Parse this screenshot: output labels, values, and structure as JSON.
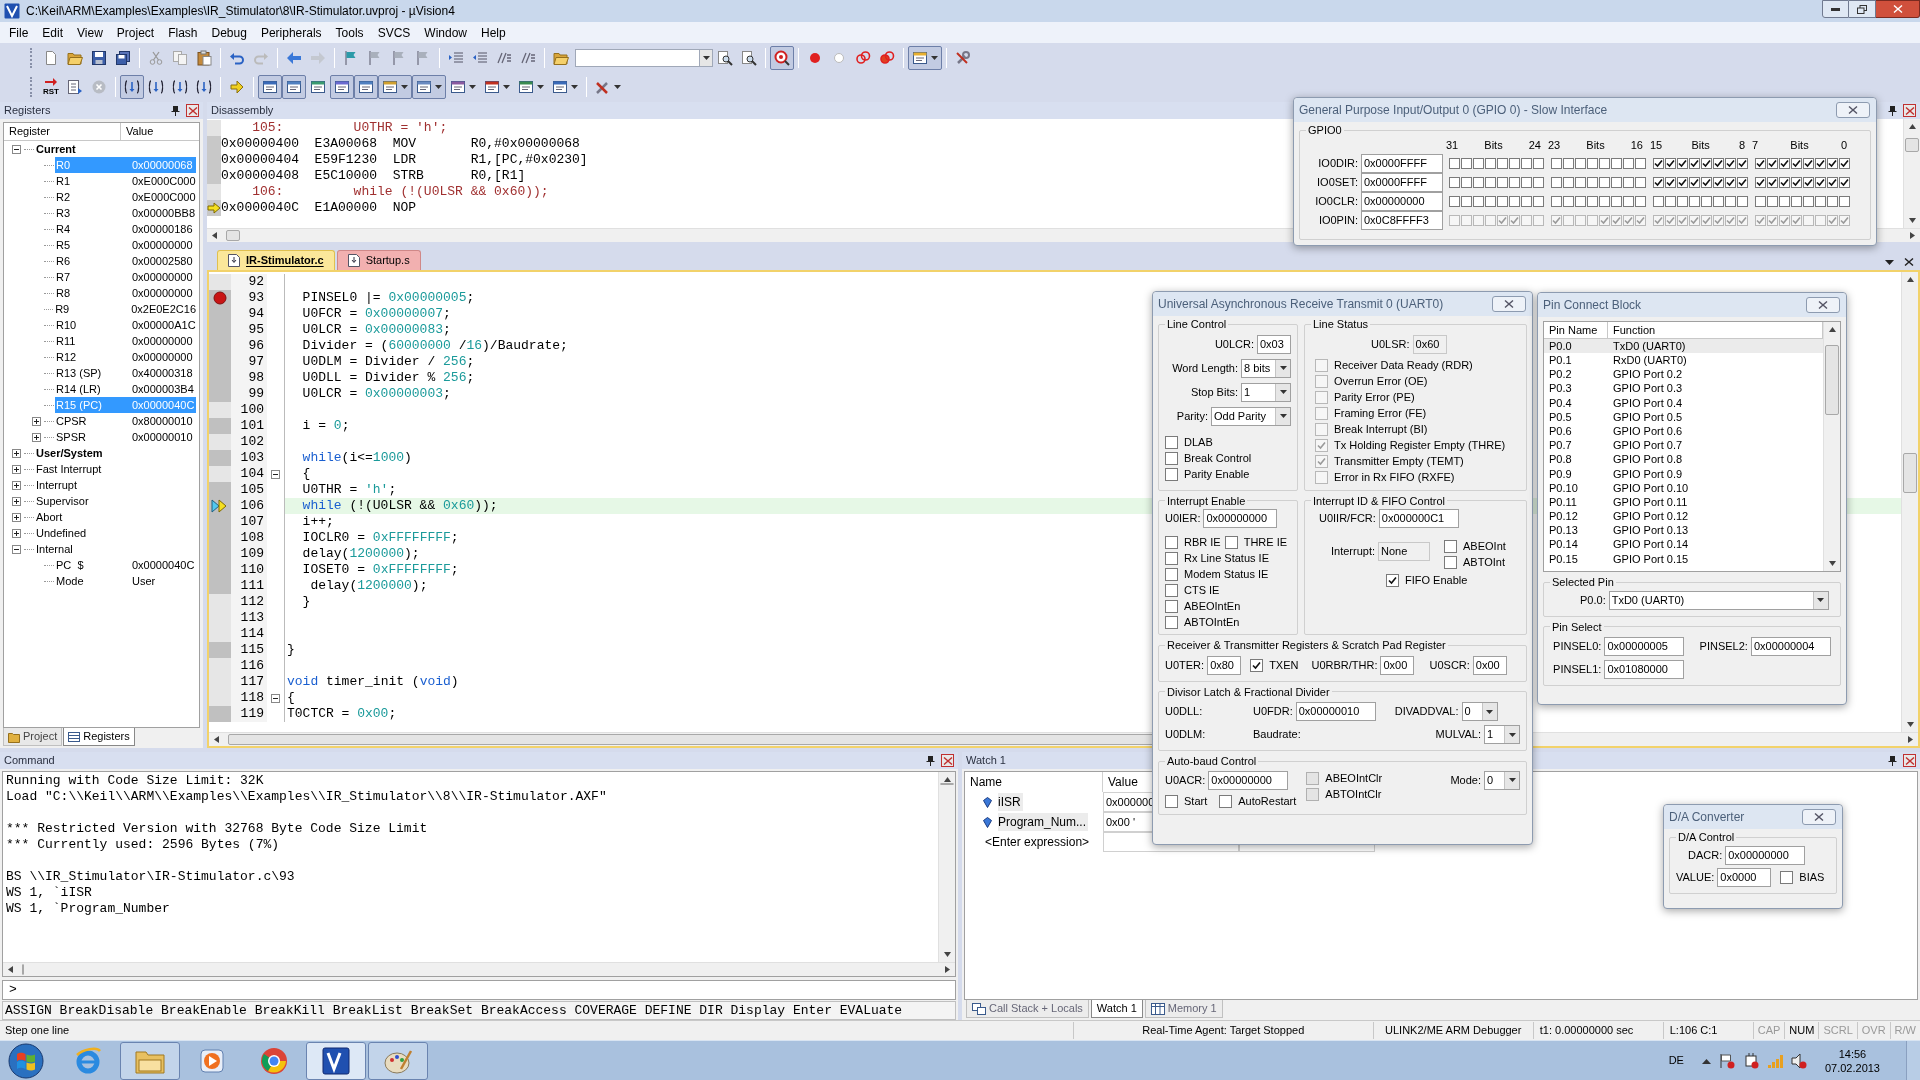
{
  "window": {
    "title": "C:\\Keil\\ARM\\Examples\\Examples\\IR_Stimulator\\8\\IR-Stimulator.uvproj - µVision4"
  },
  "menu": [
    "File",
    "Edit",
    "View",
    "Project",
    "Flash",
    "Debug",
    "Peripherals",
    "Tools",
    "SVCS",
    "Window",
    "Help"
  ],
  "toolbars": [
    {
      "buttons": [
        {
          "pressed": false
        },
        {
          "pressed": false
        },
        {
          "pressed": false
        },
        {
          "pressed": false
        },
        {
          "pressed": false
        },
        {
          "pressed": false
        },
        {
          "pressed": false
        },
        {
          "pressed": false
        },
        {
          "pressed": false
        },
        {
          "pressed": false
        },
        {
          "pressed": false
        },
        {
          "pressed": false
        },
        {
          "pressed": false
        },
        {
          "pressed": false
        },
        {
          "pressed": false
        },
        {
          "pressed": false
        },
        {
          "pressed": false
        },
        {
          "pressed": false
        },
        {
          "pressed": false
        },
        {
          "pressed": false
        },
        {
          "pressed": false
        },
        {
          "pressed": false
        },
        {
          "pressed": true
        },
        {
          "pressed": false
        },
        {
          "pressed": false
        },
        {
          "pressed": false
        },
        {
          "pressed": false
        },
        {
          "pressed": true
        },
        {
          "pressed": false
        }
      ]
    },
    {
      "buttons": [
        {
          "label": "RST",
          "pressed": false
        },
        {
          "pressed": false
        },
        {
          "pressed": false
        },
        {
          "pressed": true
        },
        {
          "pressed": false
        },
        {
          "pressed": false
        },
        {
          "pressed": false
        },
        {
          "pressed": false
        },
        {
          "pressed": true
        },
        {
          "pressed": true
        },
        {
          "pressed": false
        },
        {
          "pressed": true
        },
        {
          "pressed": true
        },
        {
          "pressed": true
        },
        {
          "pressed": true
        },
        {
          "pressed": false
        },
        {
          "pressed": false
        },
        {
          "pressed": false
        },
        {
          "pressed": false
        },
        {
          "pressed": false
        }
      ]
    }
  ],
  "registers": {
    "title": "Registers",
    "columns": [
      "Register",
      "Value"
    ],
    "tree": [
      {
        "name": "Current",
        "bold": true,
        "expanded": true,
        "selected": false,
        "children": [
          {
            "name": "R0",
            "value": "0x00000068",
            "selected": true
          },
          {
            "name": "R1",
            "value": "0xE000C000",
            "selected": false
          },
          {
            "name": "R2",
            "value": "0xE000C000",
            "selected": false
          },
          {
            "name": "R3",
            "value": "0x00000BB8",
            "selected": false
          },
          {
            "name": "R4",
            "value": "0x00000186",
            "selected": false
          },
          {
            "name": "R5",
            "value": "0x00000000",
            "selected": false
          },
          {
            "name": "R6",
            "value": "0x00002580",
            "selected": false
          },
          {
            "name": "R7",
            "value": "0x00000000",
            "selected": false
          },
          {
            "name": "R8",
            "value": "0x00000000",
            "selected": false
          },
          {
            "name": "R9",
            "value": "0x2E0E2C16",
            "selected": false
          },
          {
            "name": "R10",
            "value": "0x00000A1C",
            "selected": false
          },
          {
            "name": "R11",
            "value": "0x00000000",
            "selected": false
          },
          {
            "name": "R12",
            "value": "0x00000000",
            "selected": false
          },
          {
            "name": "R13 (SP)",
            "value": "0x40000318",
            "selected": false
          },
          {
            "name": "R14 (LR)",
            "value": "0x000003B4",
            "selected": false
          },
          {
            "name": "R15 (PC)",
            "value": "0x0000040C",
            "selected": true
          },
          {
            "name": "CPSR",
            "value": "0x80000010",
            "expanded": false,
            "selected": false
          },
          {
            "name": "SPSR",
            "value": "0x00000010",
            "expanded": false,
            "selected": false
          }
        ]
      },
      {
        "name": "User/System",
        "bold": true,
        "expanded": false,
        "selected": false
      },
      {
        "name": "Fast Interrupt",
        "bold": false,
        "expanded": false,
        "selected": false
      },
      {
        "name": "Interrupt",
        "bold": false,
        "expanded": false,
        "selected": false
      },
      {
        "name": "Supervisor",
        "bold": false,
        "expanded": false,
        "selected": false
      },
      {
        "name": "Abort",
        "bold": false,
        "expanded": false,
        "selected": false
      },
      {
        "name": "Undefined",
        "bold": false,
        "expanded": false,
        "selected": false
      },
      {
        "name": "Internal",
        "bold": false,
        "expanded": true,
        "selected": false,
        "children": [
          {
            "name": "PC  $",
            "value": "0x0000040C",
            "selected": false
          },
          {
            "name": "Mode",
            "value": "User",
            "selected": false
          }
        ]
      }
    ],
    "tabs": [
      {
        "label": "Project",
        "selected": false
      },
      {
        "label": "Registers",
        "selected": true
      }
    ]
  },
  "disassembly": {
    "title": "Disassembly",
    "lines": [
      {
        "kind": "source",
        "text": "    105:         U0THR = 'h';",
        "current": false
      },
      {
        "kind": "asm",
        "text": "0x00000400  E3A00068  MOV       R0,#0x00000068",
        "current": false
      },
      {
        "kind": "asm",
        "text": "0x00000404  E59F1230  LDR       R1,[PC,#0x0230]",
        "current": false
      },
      {
        "kind": "asm",
        "text": "0x00000408  E5C10000  STRB      R0,[R1]",
        "current": false
      },
      {
        "kind": "source",
        "text": "    106:         while (!(U0LSR && 0x60));",
        "current": false
      },
      {
        "kind": "asm",
        "text": "0x0000040C  E1A00000  NOP",
        "current": true
      }
    ]
  },
  "editor": {
    "tabs": [
      {
        "label": "IR-Stimulator.c",
        "selected": true
      },
      {
        "label": "Startup.s",
        "selected": false
      }
    ],
    "lines": [
      {
        "number": "92",
        "executable": false,
        "breakpoint": false,
        "current": false,
        "fold": false
      },
      {
        "number": "93",
        "executable": true,
        "breakpoint": true,
        "current": false,
        "fold": false,
        "segments": [
          {
            "kind": "plain",
            "text": "  PINSEL0 |= "
          },
          {
            "kind": "number",
            "text": "0x00000005"
          },
          {
            "kind": "plain",
            "text": ";"
          }
        ]
      },
      {
        "number": "94",
        "executable": true,
        "breakpoint": false,
        "current": false,
        "fold": false,
        "segments": [
          {
            "kind": "plain",
            "text": "  U0FCR = "
          },
          {
            "kind": "number",
            "text": "0x00000007"
          },
          {
            "kind": "plain",
            "text": ";"
          }
        ]
      },
      {
        "number": "95",
        "executable": true,
        "breakpoint": false,
        "current": false,
        "fold": false,
        "segments": [
          {
            "kind": "plain",
            "text": "  U0LCR = "
          },
          {
            "kind": "number",
            "text": "0x00000083"
          },
          {
            "kind": "plain",
            "text": ";"
          }
        ]
      },
      {
        "number": "96",
        "executable": true,
        "breakpoint": false,
        "current": false,
        "fold": false,
        "segments": [
          {
            "kind": "plain",
            "text": "  Divider = ("
          },
          {
            "kind": "number",
            "text": "60000000"
          },
          {
            "kind": "plain",
            "text": " /"
          },
          {
            "kind": "number",
            "text": "16"
          },
          {
            "kind": "plain",
            "text": ")/Baudrate;"
          }
        ]
      },
      {
        "number": "97",
        "executable": true,
        "breakpoint": false,
        "current": false,
        "fold": false,
        "segments": [
          {
            "kind": "plain",
            "text": "  U0DLM = Divider / "
          },
          {
            "kind": "number",
            "text": "256"
          },
          {
            "kind": "plain",
            "text": ";"
          }
        ]
      },
      {
        "number": "98",
        "executable": true,
        "breakpoint": false,
        "current": false,
        "fold": false,
        "segments": [
          {
            "kind": "plain",
            "text": "  U0DLL = Divider % "
          },
          {
            "kind": "number",
            "text": "256"
          },
          {
            "kind": "plain",
            "text": ";"
          }
        ]
      },
      {
        "number": "99",
        "executable": true,
        "breakpoint": false,
        "current": false,
        "fold": false,
        "segments": [
          {
            "kind": "plain",
            "text": "  U0LCR = "
          },
          {
            "kind": "number",
            "text": "0x00000003"
          },
          {
            "kind": "plain",
            "text": ";"
          }
        ]
      },
      {
        "number": "100",
        "executable": false,
        "breakpoint": false,
        "current": false,
        "fold": false
      },
      {
        "number": "101",
        "executable": true,
        "breakpoint": false,
        "current": false,
        "fold": false,
        "segments": [
          {
            "kind": "plain",
            "text": "  i = "
          },
          {
            "kind": "number",
            "text": "0"
          },
          {
            "kind": "plain",
            "text": ";"
          }
        ]
      },
      {
        "number": "102",
        "executable": false,
        "breakpoint": false,
        "current": false,
        "fold": false
      },
      {
        "number": "103",
        "executable": true,
        "breakpoint": false,
        "current": false,
        "fold": false,
        "segments": [
          {
            "kind": "keyword",
            "text": "  while"
          },
          {
            "kind": "plain",
            "text": "(i<="
          },
          {
            "kind": "number",
            "text": "1000"
          },
          {
            "kind": "plain",
            "text": ")"
          }
        ]
      },
      {
        "number": "104",
        "executable": false,
        "breakpoint": false,
        "current": false,
        "fold": true,
        "segments": [
          {
            "kind": "plain",
            "text": "  {"
          }
        ]
      },
      {
        "number": "105",
        "executable": true,
        "breakpoint": false,
        "current": false,
        "fold": false,
        "segments": [
          {
            "kind": "plain",
            "text": "  U0THR = "
          },
          {
            "kind": "string",
            "text": "'h'"
          },
          {
            "kind": "plain",
            "text": ";"
          }
        ]
      },
      {
        "number": "106",
        "executable": true,
        "breakpoint": false,
        "current": true,
        "fold": false,
        "segments": [
          {
            "kind": "keyword",
            "text": "  while"
          },
          {
            "kind": "plain",
            "text": " (!(U0LSR && "
          },
          {
            "kind": "number",
            "text": "0x60"
          },
          {
            "kind": "plain",
            "text": "));"
          }
        ]
      },
      {
        "number": "107",
        "executable": true,
        "breakpoint": false,
        "current": false,
        "fold": false,
        "segments": [
          {
            "kind": "plain",
            "text": "  i++;"
          }
        ]
      },
      {
        "number": "108",
        "executable": true,
        "breakpoint": false,
        "current": false,
        "fold": false,
        "segments": [
          {
            "kind": "plain",
            "text": "  IOCLR0 = "
          },
          {
            "kind": "number",
            "text": "0xFFFFFFFF"
          },
          {
            "kind": "plain",
            "text": ";"
          }
        ]
      },
      {
        "number": "109",
        "executable": true,
        "breakpoint": false,
        "current": false,
        "fold": false,
        "segments": [
          {
            "kind": "plain",
            "text": "  delay("
          },
          {
            "kind": "number",
            "text": "1200000"
          },
          {
            "kind": "plain",
            "text": ");"
          }
        ]
      },
      {
        "number": "110",
        "executable": true,
        "breakpoint": false,
        "current": false,
        "fold": false,
        "segments": [
          {
            "kind": "plain",
            "text": "  IOSET0 = "
          },
          {
            "kind": "number",
            "text": "0xFFFFFFFF"
          },
          {
            "kind": "plain",
            "text": ";"
          }
        ]
      },
      {
        "number": "111",
        "executable": true,
        "breakpoint": false,
        "current": false,
        "fold": false,
        "segments": [
          {
            "kind": "plain",
            "text": "   delay("
          },
          {
            "kind": "number",
            "text": "1200000"
          },
          {
            "kind": "plain",
            "text": ");"
          }
        ]
      },
      {
        "number": "112",
        "executable": false,
        "breakpoint": false,
        "current": false,
        "fold": false,
        "segments": [
          {
            "kind": "plain",
            "text": "  }"
          }
        ]
      },
      {
        "number": "113",
        "executable": false,
        "breakpoint": false,
        "current": false,
        "fold": false
      },
      {
        "number": "114",
        "executable": false,
        "breakpoint": false,
        "current": false,
        "fold": false
      },
      {
        "number": "115",
        "executable": true,
        "breakpoint": false,
        "current": false,
        "fold": false,
        "segments": [
          {
            "kind": "plain",
            "text": "}"
          }
        ]
      },
      {
        "number": "116",
        "executable": false,
        "breakpoint": false,
        "current": false,
        "fold": false
      },
      {
        "number": "117",
        "executable": false,
        "breakpoint": false,
        "current": false,
        "fold": false,
        "segments": [
          {
            "kind": "keyword",
            "text": "void"
          },
          {
            "kind": "plain",
            "text": " timer_init ("
          },
          {
            "kind": "keyword",
            "text": "void"
          },
          {
            "kind": "plain",
            "text": ")"
          }
        ]
      },
      {
        "number": "118",
        "executable": false,
        "breakpoint": false,
        "current": false,
        "fold": true,
        "segments": [
          {
            "kind": "plain",
            "text": "{"
          }
        ]
      },
      {
        "number": "119",
        "executable": true,
        "breakpoint": false,
        "current": false,
        "fold": false,
        "segments": [
          {
            "kind": "plain",
            "text": "T0CTCR = "
          },
          {
            "kind": "number",
            "text": "0x00"
          },
          {
            "kind": "plain",
            "text": ";"
          }
        ]
      }
    ]
  },
  "command": {
    "title": "Command",
    "blocks": [
      [
        "Running with Code Size Limit: 32K",
        "Load \"C:\\\\Keil\\\\ARM\\\\Examples\\\\Examples\\\\IR_Stimulator\\\\8\\\\IR-Stimulator.AXF\""
      ],
      [
        "*** Restricted Version with 32768 Byte Code Size Limit",
        "*** Currently used: 2596 Bytes (7%)"
      ],
      [
        "BS \\\\IR_Stimulator\\IR-Stimulator.c\\93",
        "WS 1, `iISR",
        "WS 1, `Program_Number"
      ]
    ],
    "prompt": ">",
    "keywords": "ASSIGN BreakDisable BreakEnable BreakKill BreakList BreakSet BreakAccess COVERAGE DEFINE DIR Display Enter EVALuate"
  },
  "watch": {
    "title": "Watch 1",
    "columns": [
      "Name",
      "Value"
    ],
    "rows": [
      {
        "name": "iISR",
        "value": "0x000000"
      },
      {
        "name": "Program_Num...",
        "value": "0x00 '"
      }
    ],
    "placeholder": "<Enter expression>",
    "tabs": [
      {
        "label": "Call Stack + Locals",
        "selected": false
      },
      {
        "label": "Watch 1",
        "selected": true
      },
      {
        "label": "Memory 1",
        "selected": false
      }
    ]
  },
  "gpio": {
    "title": "General Purpose Input/Output 0 (GPIO 0) - Slow Interface",
    "group": "GPIO0",
    "bit_headers": [
      {
        "high": "31",
        "label": "Bits",
        "low": "24"
      },
      {
        "high": "23",
        "label": "Bits",
        "low": "16"
      },
      {
        "high": "15",
        "label": "Bits",
        "low": "8"
      },
      {
        "high": "7",
        "label": "Bits",
        "low": "0"
      }
    ],
    "registers": [
      {
        "label": "IO0DIR:",
        "value": "0x0000FFFF",
        "disabled": false
      },
      {
        "label": "IO0SET:",
        "value": "0x0000FFFF",
        "disabled": false
      },
      {
        "label": "IO0CLR:",
        "value": "0x00000000",
        "disabled": false
      },
      {
        "label": "IO0PIN:",
        "value": "0x0C8FFFF3",
        "disabled": true
      }
    ]
  },
  "uart": {
    "title": "Universal Asynchronous Receive Transmit 0 (UART0)",
    "line_control": {
      "title": "Line Control",
      "fields": [
        {
          "label": "U0LCR:",
          "value": "0x03",
          "kind": "field"
        },
        {
          "label": "Word Length:",
          "value": "8 bits",
          "kind": "select"
        },
        {
          "label": "Stop Bits:",
          "value": "1",
          "kind": "select"
        },
        {
          "label": "Parity:",
          "value": "Odd Parity",
          "kind": "select"
        }
      ],
      "flags": [
        {
          "label": "DLAB",
          "checked": false
        },
        {
          "label": "Break Control",
          "checked": false
        },
        {
          "label": "Parity Enable",
          "checked": false
        }
      ]
    },
    "line_status": {
      "title": "Line Status",
      "register": {
        "label": "U0LSR:",
        "value": "0x60"
      },
      "flags": [
        {
          "label": "Receiver Data Ready (RDR)",
          "checked": false
        },
        {
          "label": "Overrun Error (OE)",
          "checked": false
        },
        {
          "label": "Parity Error (PE)",
          "checked": false
        },
        {
          "label": "Framing Error (FE)",
          "checked": false
        },
        {
          "label": "Break Interrupt (BI)",
          "checked": false
        },
        {
          "label": "Tx Holding Register Empty (THRE)",
          "checked": true
        },
        {
          "label": "Transmitter Empty (TEMT)",
          "checked": true
        },
        {
          "label": "Error in Rx FIFO (RXFE)",
          "checked": false
        }
      ]
    },
    "interrupt_enable": {
      "title": "Interrupt Enable",
      "register": {
        "label": "U0IER:",
        "value": "0x00000000"
      },
      "flags": [
        {
          "label": "RBR IE",
          "checked": false
        },
        {
          "label": "THRE IE",
          "checked": false
        },
        {
          "label": "Rx Line Status IE",
          "checked": false
        },
        {
          "label": "Modem Status IE",
          "checked": false
        },
        {
          "label": "CTS IE",
          "checked": false
        },
        {
          "label": "ABEOIntEn",
          "checked": false
        },
        {
          "label": "ABTOIntEn",
          "checked": false
        }
      ]
    },
    "interrupt_id": {
      "title": "Interrupt ID & FIFO Control",
      "register": {
        "label": "U0IIR/FCR:",
        "value": "0x000000C1"
      },
      "interrupt": {
        "label": "Interrupt:",
        "value": "None"
      },
      "flags": [
        {
          "label": "ABEOInt",
          "checked": false
        },
        {
          "label": "ABTOInt",
          "checked": false
        }
      ],
      "fifo": {
        "label": "FIFO Enable",
        "checked": true
      }
    },
    "rx_tx": {
      "title": "Receiver & Transmitter Registers & Scratch Pad Register",
      "ter": {
        "label": "U0TER:",
        "value": "0x80"
      },
      "txen": {
        "label": "TXEN",
        "checked": true
      },
      "rbr": {
        "label": "U0RBR/THR:",
        "value": "0x00"
      },
      "scr": {
        "label": "U0SCR:",
        "value": "0x00"
      }
    },
    "divisor": {
      "title": "Divisor Latch & Fractional Divider",
      "dll": {
        "label": "U0DLL:"
      },
      "fdr": {
        "label": "U0FDR:",
        "value": "0x00000010"
      },
      "divaddval": {
        "label": "DIVADDVAL:",
        "value": "0"
      },
      "dlm": {
        "label": "U0DLM:"
      },
      "baudrate": {
        "label": "Baudrate:"
      },
      "mulval": {
        "label": "MULVAL:",
        "value": "1"
      }
    },
    "autobaud": {
      "title": "Auto-baud Control",
      "acr": {
        "label": "U0ACR:",
        "value": "0x00000000"
      },
      "clear_flags": [
        {
          "label": "ABEOIntClr",
          "checked": false
        },
        {
          "label": "ABTOIntClr",
          "checked": false
        }
      ],
      "mode": {
        "label": "Mode:",
        "value": "0"
      },
      "flags": [
        {
          "label": "Start",
          "checked": false
        },
        {
          "label": "AutoRestart",
          "checked": false
        }
      ]
    }
  },
  "pin_connect": {
    "title": "Pin Connect Block",
    "columns": [
      "Pin Name",
      "Function"
    ],
    "pins": [
      {
        "pin": "P0.0",
        "function": "TxD0 (UART0)",
        "selected": true
      },
      {
        "pin": "P0.1",
        "function": "RxD0 (UART0)",
        "selected": false
      },
      {
        "pin": "P0.2",
        "function": "GPIO Port 0.2",
        "selected": false
      },
      {
        "pin": "P0.3",
        "function": "GPIO Port 0.3",
        "selected": false
      },
      {
        "pin": "P0.4",
        "function": "GPIO Port 0.4",
        "selected": false
      },
      {
        "pin": "P0.5",
        "function": "GPIO Port 0.5",
        "selected": false
      },
      {
        "pin": "P0.6",
        "function": "GPIO Port 0.6",
        "selected": false
      },
      {
        "pin": "P0.7",
        "function": "GPIO Port 0.7",
        "selected": false
      },
      {
        "pin": "P0.8",
        "function": "GPIO Port 0.8",
        "selected": false
      },
      {
        "pin": "P0.9",
        "function": "GPIO Port 0.9",
        "selected": false
      },
      {
        "pin": "P0.10",
        "function": "GPIO Port 0.10",
        "selected": false
      },
      {
        "pin": "P0.11",
        "function": "GPIO Port 0.11",
        "selected": false
      },
      {
        "pin": "P0.12",
        "function": "GPIO Port 0.12",
        "selected": false
      },
      {
        "pin": "P0.13",
        "function": "GPIO Port 0.13",
        "selected": false
      },
      {
        "pin": "P0.14",
        "function": "GPIO Port 0.14",
        "selected": false
      },
      {
        "pin": "P0.15",
        "function": "GPIO Port 0.15",
        "selected": false
      }
    ],
    "selected_pin": {
      "title": "Selected Pin",
      "label": "P0.0:",
      "value": "TxD0 (UART0)"
    },
    "pin_select": {
      "title": "Pin Select",
      "fields": [
        {
          "label": "PINSEL0:",
          "value": "0x00000005"
        },
        {
          "label": "PINSEL2:",
          "value": "0x00000004"
        },
        {
          "label": "PINSEL1:",
          "value": "0x01080000"
        }
      ]
    }
  },
  "dac": {
    "title": "D/A Converter",
    "group": "D/A Control",
    "dacr": {
      "label": "DACR:",
      "value": "0x00000000"
    },
    "value": {
      "label": "VALUE:",
      "value": "0x0000"
    },
    "bias": {
      "label": "BIAS",
      "checked": false
    }
  },
  "status_bar": {
    "message": "Step one line",
    "fields": [
      "Real-Time Agent: Target Stopped",
      "ULINK2/ME ARM Debugger",
      "t1: 0.00000000 sec",
      "L:106 C:1"
    ],
    "indicators": [
      {
        "label": "CAP",
        "on": false
      },
      {
        "label": "NUM",
        "on": true
      },
      {
        "label": "SCRL",
        "on": false
      },
      {
        "label": "OVR",
        "on": false
      },
      {
        "label": "R/W",
        "on": false
      }
    ]
  },
  "taskbar": {
    "apps": [
      {
        "running": false,
        "selected": false
      },
      {
        "running": true,
        "selected": false
      },
      {
        "running": false,
        "selected": false
      },
      {
        "running": false,
        "selected": false
      },
      {
        "running": true,
        "selected": true
      },
      {
        "running": true,
        "selected": false
      }
    ],
    "language": "DE",
    "time": "14:56",
    "date": "07.02.2013"
  }
}
